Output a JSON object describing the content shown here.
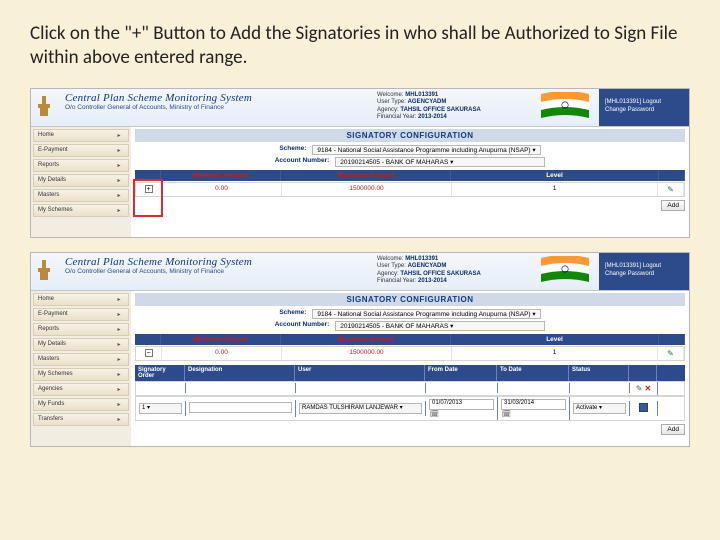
{
  "instruction": "Click on the \"+\" Button to Add the Signatories in who shall be Authorized to Sign File within above entered range.",
  "app": {
    "title": "Central Plan Scheme Monitoring System",
    "subtitle": "O/o Controller General of Accounts, Ministry of Finance"
  },
  "meta": {
    "welcome_lbl": "Welcome:",
    "welcome_val": "MHL013391",
    "usertype_lbl": "User Type:",
    "usertype_val": "AGENCYADM",
    "agency_lbl": "Agency:",
    "agency_val": "TAHSIL OFFICE SAKURASA",
    "fy_lbl": "Financial Year:",
    "fy_val": "2013-2014"
  },
  "corner": {
    "user": "[MHL013391] Logout",
    "link": "Change Password"
  },
  "sidenav1": [
    "Home",
    "E-Payment",
    "Reports",
    "My Details",
    "Masters",
    "My Schemes"
  ],
  "sidenav2": [
    "Home",
    "E-Payment",
    "Reports",
    "My Details",
    "Masters",
    "My Schemes",
    "Agencies",
    "My Funds",
    "Transfers"
  ],
  "section_title": "SIGNATORY CONFIGURATION",
  "form": {
    "scheme_lbl": "Scheme:",
    "scheme_val": "9184 - National Social Assistance Programme including Anupurna (NSAP)",
    "acct_lbl": "Account Number:",
    "acct_val": "20190214505 - BANK OF MAHARAS"
  },
  "cols": {
    "min": "Minimum Amount",
    "max": "Maximum Amount",
    "lvl": "Level"
  },
  "range_row": {
    "min": "0.00",
    "max": "1500000.00",
    "lvl": "1"
  },
  "add_label": "Add",
  "sig_cols": {
    "order": "Signatory Order",
    "desig": "Designation",
    "user": "User",
    "from": "From Date",
    "to": "To Date",
    "status": "Status"
  },
  "sig_row": {
    "order": "1",
    "user": "RAMDAS TULSHIRAM LANJEWAR",
    "from": "01/07/2013",
    "to": "31/03/2014",
    "status": "Activate"
  }
}
